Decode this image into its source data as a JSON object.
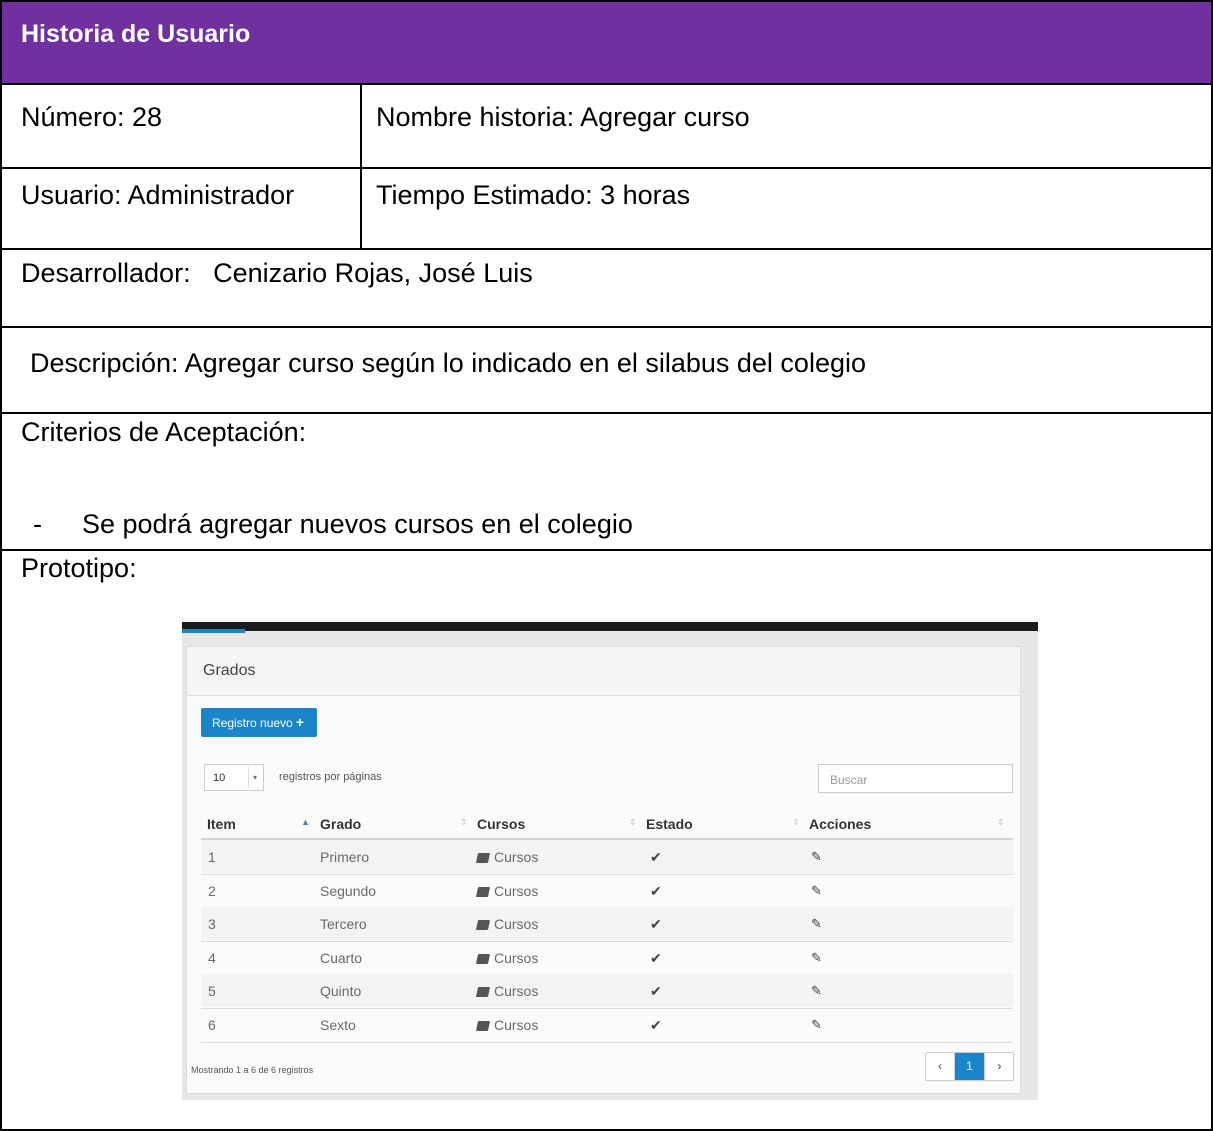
{
  "header": {
    "title": "Historia de Usuario"
  },
  "fields": {
    "numero": "Número: 28",
    "nombre_historia": "Nombre historia: Agregar curso",
    "usuario": "Usuario: Administrador",
    "tiempo": "Tiempo Estimado: 3 horas",
    "desarrollador": "Desarrollador:   Cenizario Rojas, José Luis",
    "descripcion": "Descripción: Agregar curso según lo indicado en el silabus del colegio",
    "criterios_label": "Criterios de Aceptación:",
    "criterio_bullet": "-",
    "criterio_1": "Se podrá agregar nuevos cursos en el colegio",
    "prototipo_label": "Prototipo:"
  },
  "prototype": {
    "panel_title": "Grados",
    "new_button": "Registro nuevo",
    "new_button_icon": "+",
    "page_size": "10",
    "page_size_arrow": "▾",
    "per_page_label": "registros por páginas",
    "search_placeholder": "Buscar",
    "columns": [
      "Item",
      "Grado",
      "Cursos",
      "Estado",
      "Acciones"
    ],
    "sort_active": "▲",
    "sort_idle": "⇕",
    "rows": [
      {
        "item": "1",
        "grado": "Primero",
        "cursos": "Cursos",
        "estado": "✔",
        "accion": "✎"
      },
      {
        "item": "2",
        "grado": "Segundo",
        "cursos": "Cursos",
        "estado": "✔",
        "accion": "✎"
      },
      {
        "item": "3",
        "grado": "Tercero",
        "cursos": "Cursos",
        "estado": "✔",
        "accion": "✎"
      },
      {
        "item": "4",
        "grado": "Cuarto",
        "cursos": "Cursos",
        "estado": "✔",
        "accion": "✎"
      },
      {
        "item": "5",
        "grado": "Quinto",
        "cursos": "Cursos",
        "estado": "✔",
        "accion": "✎"
      },
      {
        "item": "6",
        "grado": "Sexto",
        "cursos": "Cursos",
        "estado": "✔",
        "accion": "✎"
      }
    ],
    "footer_text": "Mostrando 1 a 6 de 6 registros",
    "pager": {
      "prev": "‹",
      "current": "1",
      "next": "›"
    },
    "colors": {
      "accent": "#1a85c8",
      "header": "#7030a0"
    }
  }
}
